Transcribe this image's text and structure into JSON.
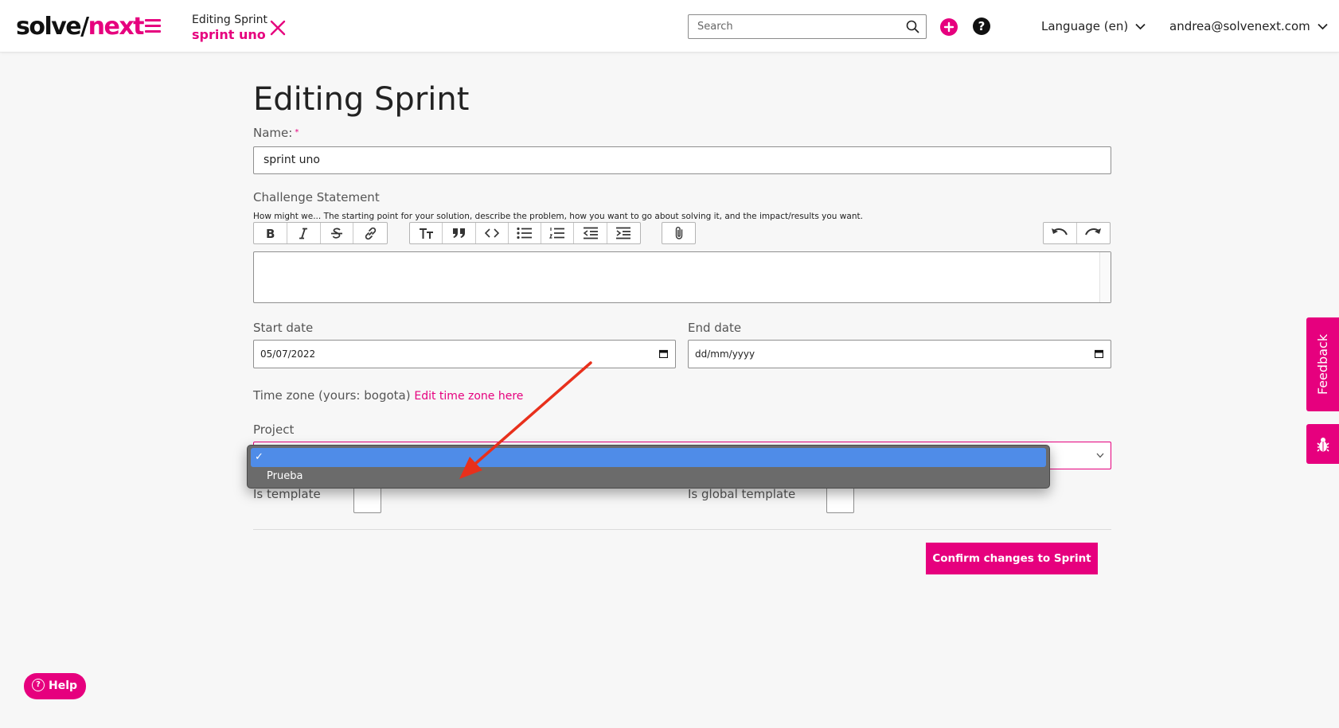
{
  "header": {
    "logo_left": "solve/",
    "logo_right": "next",
    "crumb_title": "Editing Sprint",
    "crumb_subtitle": "sprint uno",
    "search_placeholder": "Search",
    "language": "Language (en)",
    "user": "andrea@solvenext.com"
  },
  "form": {
    "title": "Editing Sprint",
    "name_label": "Name:",
    "name_required": "*",
    "name_value": "sprint uno",
    "challenge_label": "Challenge Statement",
    "challenge_hint": "How might we... The starting point for your solution, describe the problem, how you want to go about solving it, and the impact/results you want.",
    "start_date_label": "Start date",
    "start_date_value": "05/07/2022",
    "end_date_label": "End date",
    "end_date_value": "dd/mm/yyyy",
    "timezone_text": "Time zone (yours: bogota)",
    "timezone_link": "Edit time zone here",
    "project_label": "Project",
    "is_template_label": "Is template",
    "is_global_template_label": "Is global template",
    "confirm_label": "Confirm changes to Sprint"
  },
  "dropdown": {
    "options": [
      {
        "label": "",
        "selected": true
      },
      {
        "label": "Prueba",
        "selected": false
      }
    ]
  },
  "toolbar": {
    "group1": [
      "bold-icon",
      "italic-icon",
      "strikethrough-icon",
      "link-icon"
    ],
    "group2": [
      "heading-icon",
      "quote-icon",
      "code-icon",
      "bullet-list-icon",
      "numbered-list-icon",
      "outdent-icon",
      "indent-icon"
    ],
    "group3": [
      "attachment-icon"
    ],
    "group4": [
      "undo-icon",
      "redo-icon"
    ]
  },
  "side": {
    "feedback_label": "Feedback",
    "help_label": "Help"
  },
  "colors": {
    "accent": "#e6007e",
    "selection": "#4f8ce8",
    "annotation_arrow": "#e8301c"
  }
}
